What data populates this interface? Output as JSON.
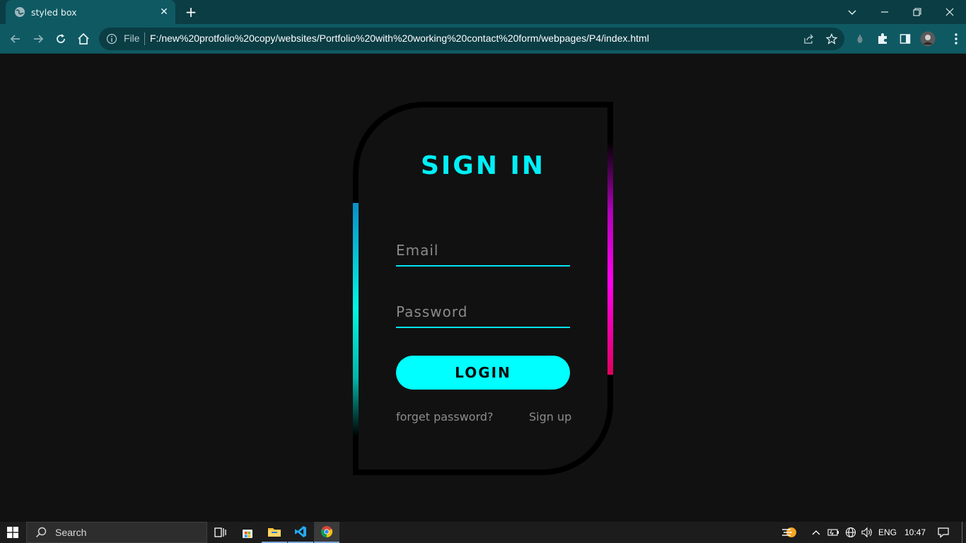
{
  "browser": {
    "tab_title": "styled box",
    "omnibox": {
      "scheme_label": "File",
      "url": "F:/new%20protfolio%20copy/websites/Portfolio%20with%20working%20contact%20form/webpages/P4/index.html"
    }
  },
  "page": {
    "title": "SIGN IN",
    "email_placeholder": "Email",
    "password_placeholder": "Password",
    "login_label": "LOGIN",
    "forget_link": "forget password?",
    "signup_link": "Sign up",
    "colors": {
      "background": "#111111",
      "card_border": "#000000",
      "accent_cyan": "#00ffff",
      "accent_magenta": "#ff00ef"
    }
  },
  "taskbar": {
    "search_label": "Search",
    "language": "ENG",
    "time": "10:47"
  }
}
